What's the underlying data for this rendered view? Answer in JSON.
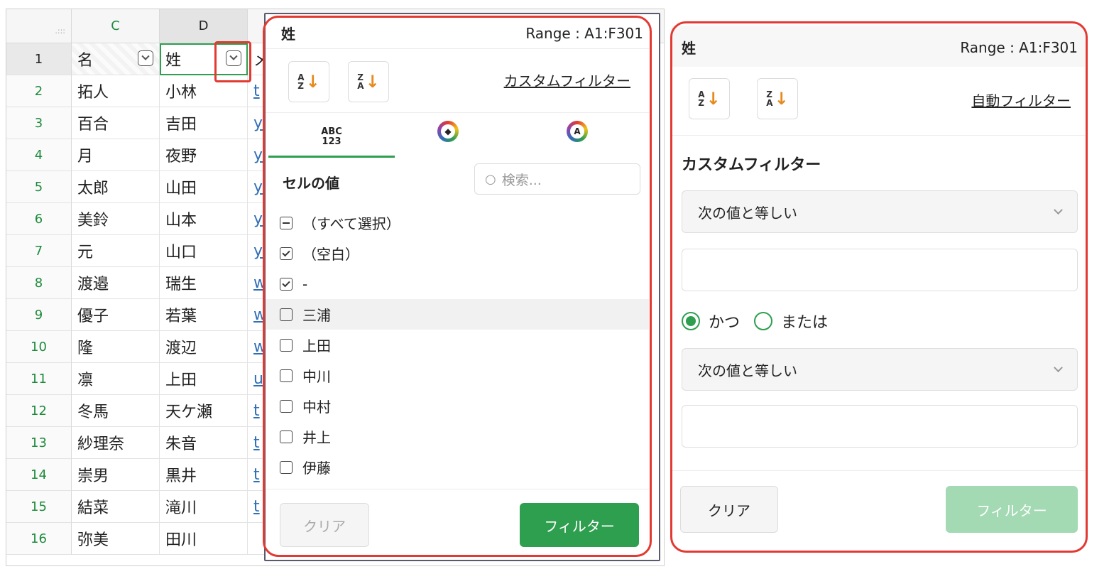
{
  "sheet": {
    "columns": [
      "C",
      "D"
    ],
    "corner_glyph": ".:::",
    "header_row": {
      "num": "1",
      "c": "名",
      "d": "姓",
      "e": "メ"
    },
    "rows": [
      {
        "num": "2",
        "c": "拓人",
        "d": "小林",
        "e": "t"
      },
      {
        "num": "3",
        "c": "百合",
        "d": "吉田",
        "e": "y"
      },
      {
        "num": "4",
        "c": "月",
        "d": "夜野",
        "e": "y"
      },
      {
        "num": "5",
        "c": "太郎",
        "d": "山田",
        "e": "y"
      },
      {
        "num": "6",
        "c": "美鈴",
        "d": "山本",
        "e": "y"
      },
      {
        "num": "7",
        "c": "元",
        "d": "山口",
        "e": "y"
      },
      {
        "num": "8",
        "c": "渡邉",
        "d": "瑞生",
        "e": "w"
      },
      {
        "num": "9",
        "c": "優子",
        "d": "若葉",
        "e": "w"
      },
      {
        "num": "10",
        "c": "隆",
        "d": "渡辺",
        "e": "w"
      },
      {
        "num": "11",
        "c": "凛",
        "d": "上田",
        "e": "u"
      },
      {
        "num": "12",
        "c": "冬馬",
        "d": "天ケ瀬",
        "e": "t"
      },
      {
        "num": "13",
        "c": "紗理奈",
        "d": "朱音",
        "e": "t"
      },
      {
        "num": "14",
        "c": "崇男",
        "d": "黒井",
        "e": "t"
      },
      {
        "num": "15",
        "c": "結菜",
        "d": "滝川",
        "e": "t"
      },
      {
        "num": "16",
        "c": "弥美",
        "d": "田川",
        "e": ""
      }
    ]
  },
  "panel1": {
    "title": "姓",
    "range": "Range : A1:F301",
    "custom_filter_link": "カスタムフィルター",
    "tab_values_line1": "ABC",
    "tab_values_line2": "123",
    "section_label": "セルの値",
    "search_placeholder": "検索...",
    "items": [
      {
        "label": "（すべて選択）",
        "state": "ind"
      },
      {
        "label": "（空白）",
        "state": "on"
      },
      {
        "label": "-",
        "state": "on"
      },
      {
        "label": "三浦",
        "state": "off"
      },
      {
        "label": "上田",
        "state": "off"
      },
      {
        "label": "中川",
        "state": "off"
      },
      {
        "label": "中村",
        "state": "off"
      },
      {
        "label": "井上",
        "state": "off"
      },
      {
        "label": "伊藤",
        "state": "off"
      }
    ],
    "clear_label": "クリア",
    "filter_label": "フィルター"
  },
  "panel2": {
    "title": "姓",
    "range": "Range : A1:F301",
    "auto_filter_link": "自動フィルター",
    "section_title": "カスタムフィルター",
    "condition1": "次の値と等しい",
    "and_label": "かつ",
    "or_label": "または",
    "condition2": "次の値と等しい",
    "clear_label": "クリア",
    "filter_label": "フィルター"
  },
  "sort": {
    "az_top": "A",
    "az_bottom": "Z",
    "za_top": "Z",
    "za_bottom": "A",
    "arrow": "↓"
  },
  "colors": {
    "accent": "#2e9e4f",
    "highlight": "#e23a32",
    "sort_arrow": "#e68a1e",
    "link": "#2f6fb5"
  }
}
